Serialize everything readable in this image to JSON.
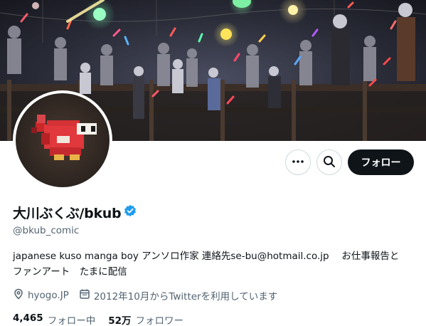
{
  "profile": {
    "display_name": "大川ぶくぶ/bkub",
    "handle": "@bkub_comic",
    "bio": "japanese kuso manga boy アンソロ作家 連絡先se-bu@hotmail.co.jp　 お仕事報告と\nファンアート　たまに配信",
    "location": "hyogo.JP",
    "joined": "2012年10月からTwitterを利用しています",
    "verified": true
  },
  "actions": {
    "follow_label": "フォロー"
  },
  "stats": {
    "following_count": "4,465",
    "following_label": "フォロー中",
    "followers_count": "52万",
    "followers_label": "フォロワー"
  },
  "icons": [
    "more-icon",
    "search-icon",
    "verified-icon",
    "location-icon",
    "calendar-icon"
  ],
  "colors": {
    "accent": "#1d9bf0",
    "text": "#0f1419",
    "secondary": "#536471",
    "button_bg": "#0f1419"
  }
}
